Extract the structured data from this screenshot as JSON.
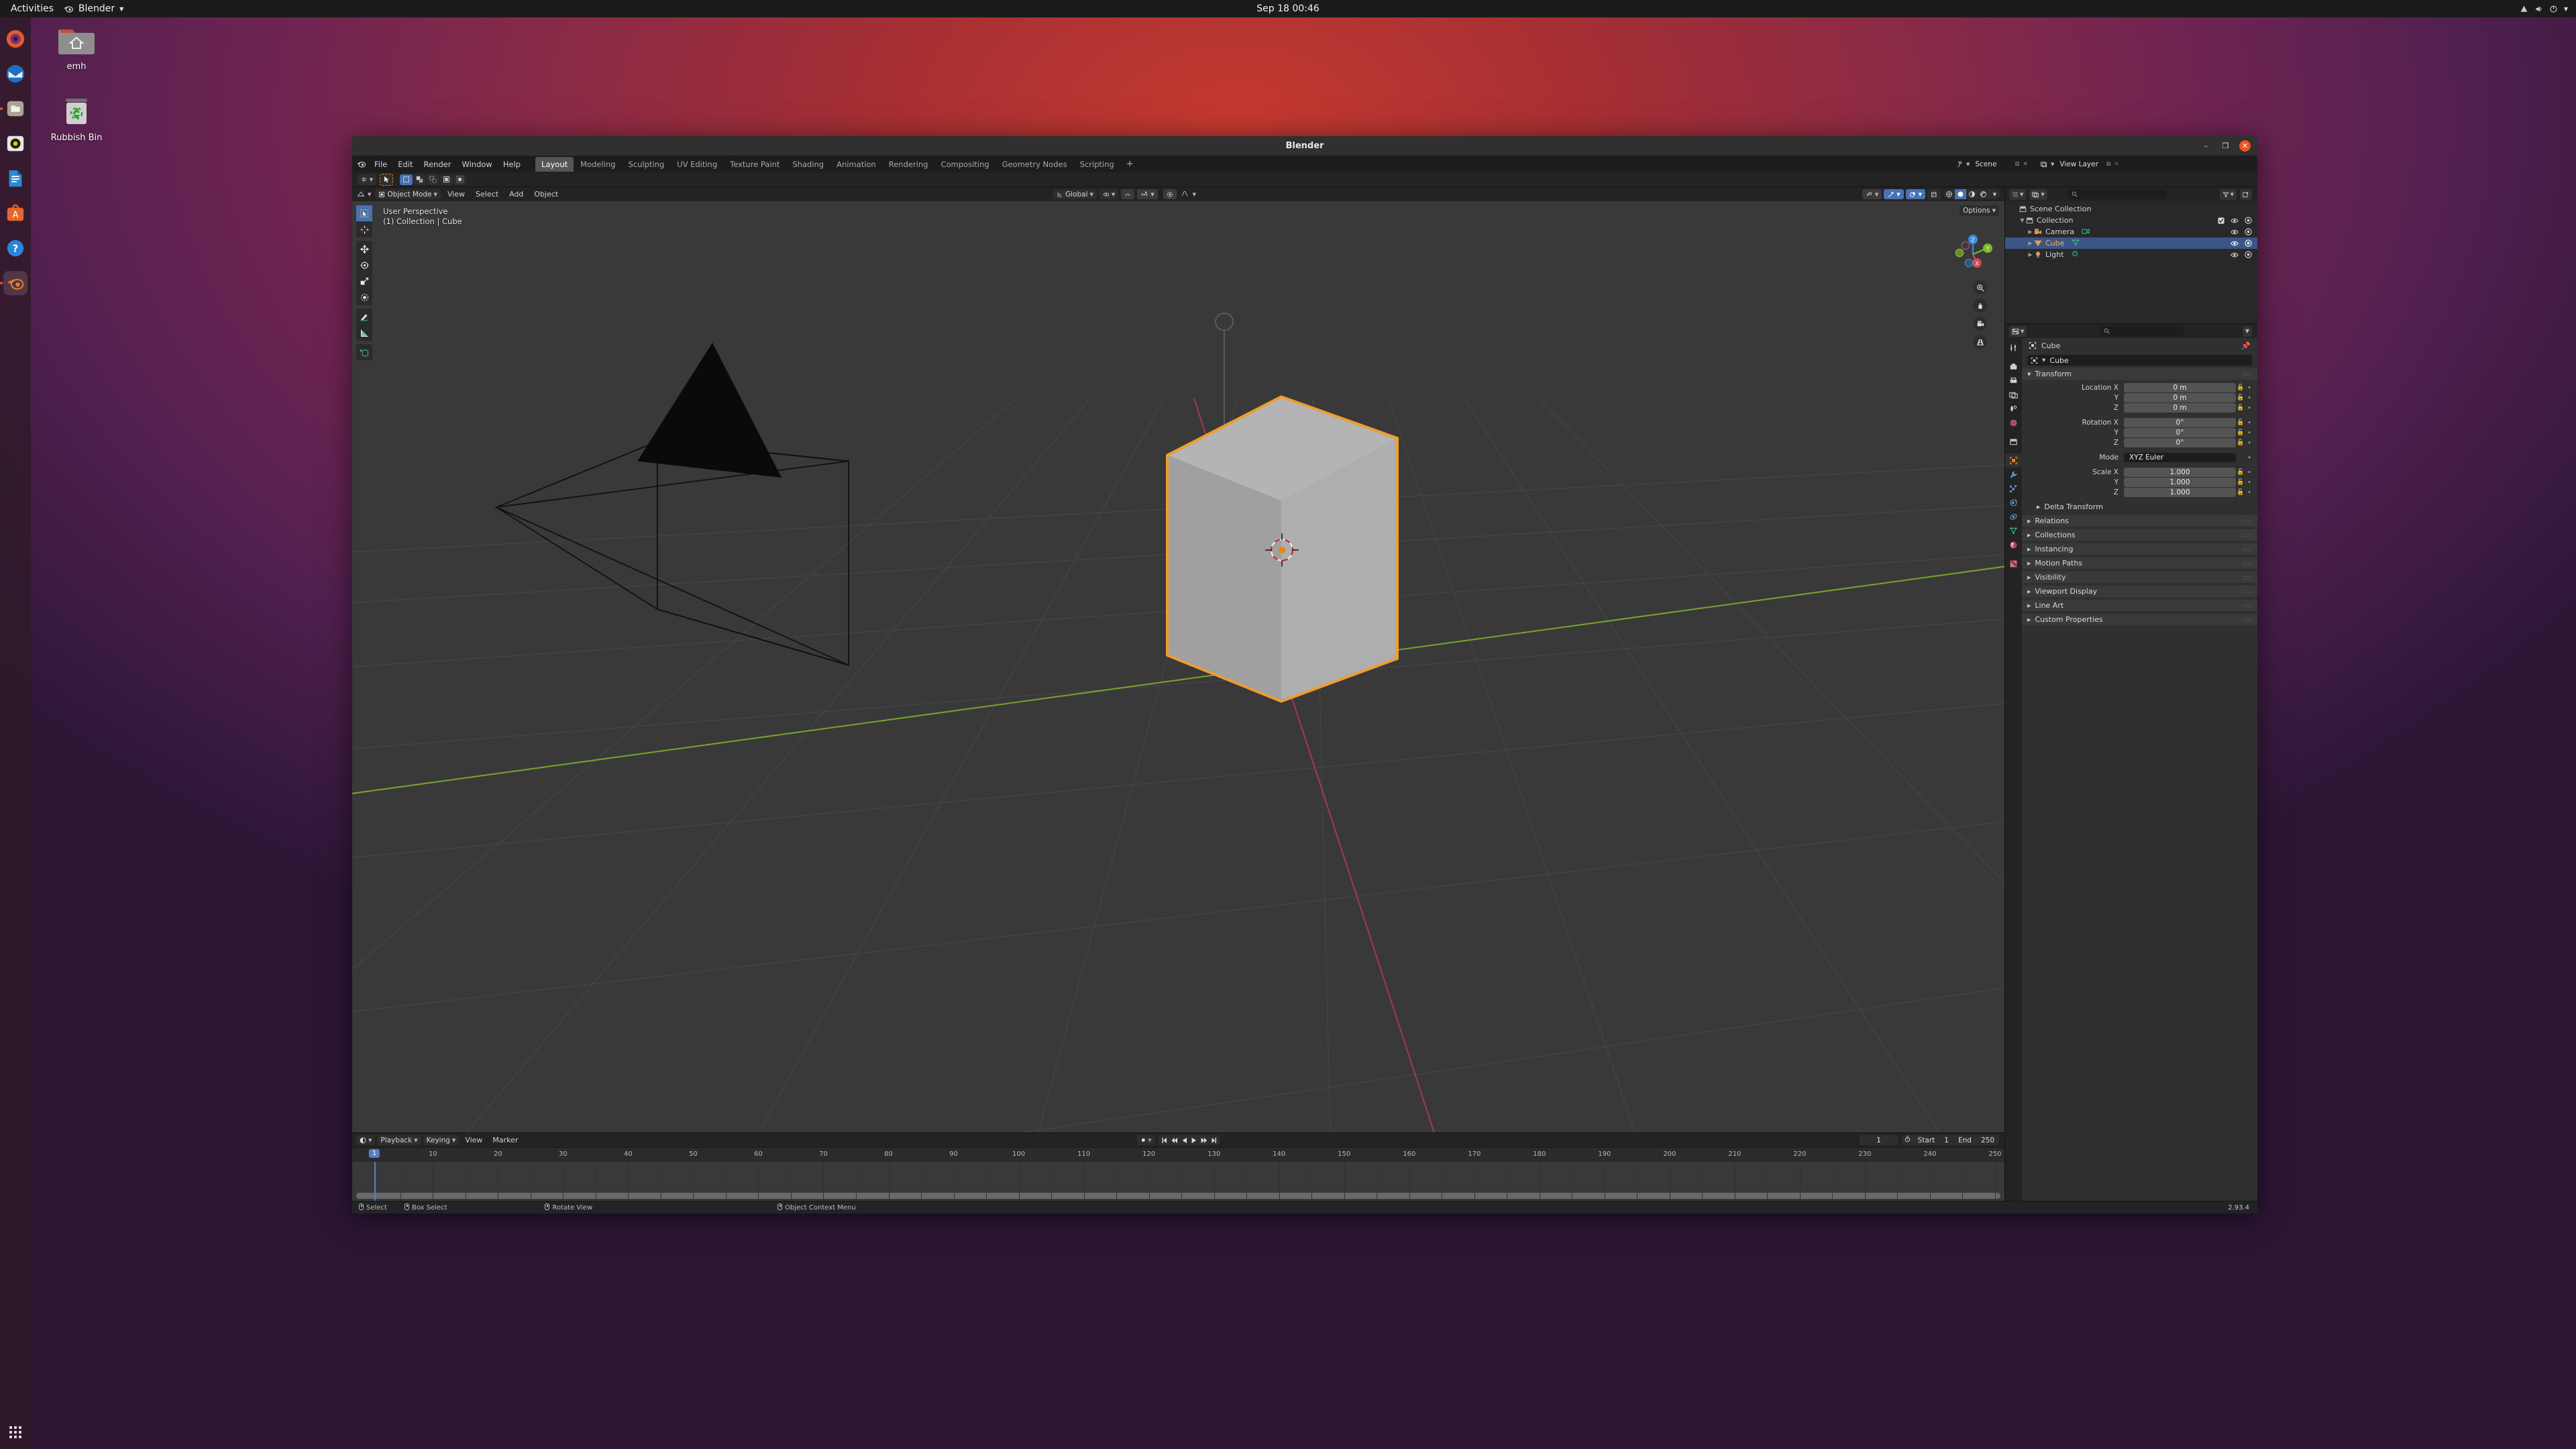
{
  "desktop": {
    "topbar": {
      "activities": "Activities",
      "app_menu": "Blender",
      "clock": "Sep 18  00:46",
      "tray_icons": [
        "network-icon",
        "volume-icon",
        "power-icon",
        "chevron-down-icon"
      ]
    },
    "dock_items": [
      {
        "name": "firefox",
        "running": false
      },
      {
        "name": "thunderbird",
        "running": false
      },
      {
        "name": "files",
        "running": true
      },
      {
        "name": "rhythmbox",
        "running": false
      },
      {
        "name": "libreoffice-writer",
        "running": false
      },
      {
        "name": "ubuntu-software",
        "running": false
      },
      {
        "name": "help",
        "running": false
      },
      {
        "name": "blender",
        "running": true
      }
    ],
    "icons": [
      {
        "label": "emh",
        "type": "home-folder"
      },
      {
        "label": "Rubbish Bin",
        "type": "trash"
      }
    ]
  },
  "window": {
    "title": "Blender",
    "controls": {
      "minimize": "–",
      "maximize": "❐",
      "close": "✕"
    }
  },
  "topbar": {
    "menus": [
      "File",
      "Edit",
      "Render",
      "Window",
      "Help"
    ],
    "workspaces": [
      "Layout",
      "Modeling",
      "Sculpting",
      "UV Editing",
      "Texture Paint",
      "Shading",
      "Animation",
      "Rendering",
      "Compositing",
      "Geometry Nodes",
      "Scripting"
    ],
    "active_workspace": "Layout",
    "add_workspace": "+",
    "scene_name": "Scene",
    "view_layer_name": "View Layer"
  },
  "tool_settings": {
    "mode_icon": "select-mode-icon",
    "cursor_icon": "tweak-cursor-icon",
    "select_modes": [
      "set-select",
      "extend-select",
      "subtract-select",
      "invert-select",
      "intersect-select"
    ],
    "active_select_mode": "set-select"
  },
  "viewport": {
    "header": {
      "mode": "Object Mode",
      "menus": [
        "View",
        "Select",
        "Add",
        "Object"
      ],
      "transform_orientation": "Global",
      "snap_label": "snap-magnet-icon",
      "proportional_label": "proportional-edit-icon",
      "options": "Options",
      "shading_modes": [
        "wireframe",
        "solid",
        "material-preview",
        "rendered"
      ],
      "active_shading": "solid"
    },
    "overlay_line1": "User Perspective",
    "overlay_line2": "(1) Collection | Cube",
    "toolbar_tools": [
      "tweak-select-box",
      "cursor",
      "move",
      "rotate",
      "scale",
      "transform",
      "annotate",
      "measure",
      "add-cube"
    ],
    "active_tool": "tweak-select-box",
    "gizmo_axes": [
      "X",
      "Y",
      "Z"
    ],
    "nav_buttons": [
      "zoom-icon",
      "pan-hand-icon",
      "camera-view-icon",
      "toggle-perspective-icon"
    ],
    "objects": [
      "Cube",
      "Camera",
      "Light"
    ]
  },
  "outliner": {
    "display_mode": "view-layer-icon",
    "filter_icon": "filter-icon",
    "new_collection_icon": "new-collection-icon",
    "search_placeholder": "",
    "rows": [
      {
        "label": "Scene Collection",
        "icon": "collection-icon",
        "indent": 0,
        "selected": false,
        "expander": "",
        "has_toggles": false,
        "data_icon": ""
      },
      {
        "label": "Collection",
        "icon": "collection-icon",
        "indent": 1,
        "selected": false,
        "expander": "▼",
        "has_toggles": true,
        "checkbox": true,
        "data_icon": ""
      },
      {
        "label": "Camera",
        "icon": "camera-object-icon",
        "indent": 2,
        "selected": false,
        "expander": "▶",
        "has_toggles": true,
        "data_icon": "camera-data-icon"
      },
      {
        "label": "Cube",
        "icon": "mesh-object-icon",
        "indent": 2,
        "selected": true,
        "expander": "▶",
        "has_toggles": true,
        "data_icon": "mesh-data-icon"
      },
      {
        "label": "Light",
        "icon": "light-object-icon",
        "indent": 2,
        "selected": false,
        "expander": "▶",
        "has_toggles": true,
        "data_icon": "light-data-icon"
      }
    ]
  },
  "properties": {
    "search_placeholder": "",
    "tabs": [
      "tool-icon",
      "render-icon",
      "output-icon",
      "view-layer-icon",
      "scene-icon",
      "world-icon",
      "collection-icon",
      "object-icon",
      "modifier-icon",
      "particles-icon",
      "physics-icon",
      "constraints-icon",
      "data-icon",
      "material-icon",
      "texture-icon"
    ],
    "active_tab": "object-icon",
    "breadcrumb_object": "Cube",
    "name_field": "Cube",
    "panels": [
      {
        "label": "Transform",
        "open": true
      },
      {
        "label": "Delta Transform",
        "open": false,
        "sub": true
      },
      {
        "label": "Relations",
        "open": false
      },
      {
        "label": "Collections",
        "open": false
      },
      {
        "label": "Instancing",
        "open": false
      },
      {
        "label": "Motion Paths",
        "open": false
      },
      {
        "label": "Visibility",
        "open": false
      },
      {
        "label": "Viewport Display",
        "open": false
      },
      {
        "label": "Line Art",
        "open": false
      },
      {
        "label": "Custom Properties",
        "open": false
      }
    ],
    "transform": {
      "location": [
        {
          "label": "Location X",
          "value": "0 m"
        },
        {
          "label": "Y",
          "value": "0 m"
        },
        {
          "label": "Z",
          "value": "0 m"
        }
      ],
      "rotation": [
        {
          "label": "Rotation X",
          "value": "0°"
        },
        {
          "label": "Y",
          "value": "0°"
        },
        {
          "label": "Z",
          "value": "0°"
        }
      ],
      "mode": {
        "label": "Mode",
        "value": "XYZ Euler"
      },
      "scale": [
        {
          "label": "Scale X",
          "value": "1.000"
        },
        {
          "label": "Y",
          "value": "1.000"
        },
        {
          "label": "Z",
          "value": "1.000"
        }
      ]
    }
  },
  "timeline": {
    "editor_icon": "timeline-editor-icon",
    "menus": [
      "Playback",
      "Keying",
      "View",
      "Marker"
    ],
    "playback_controls": [
      "jump-to-start",
      "jump-prev-keyframe",
      "play-reverse",
      "play",
      "jump-next-keyframe",
      "jump-to-end"
    ],
    "current_frame": "1",
    "start_label": "Start",
    "start_value": "1",
    "end_label": "End",
    "end_value": "250",
    "ruler_ticks": [
      "1",
      "10",
      "20",
      "30",
      "40",
      "50",
      "60",
      "70",
      "80",
      "90",
      "100",
      "110",
      "120",
      "130",
      "140",
      "150",
      "160",
      "170",
      "180",
      "190",
      "200",
      "210",
      "220",
      "230",
      "240",
      "250"
    ],
    "playhead_frame": "1"
  },
  "statusbar": {
    "hints": [
      {
        "icon": "mouse-left-icon",
        "label": "Select"
      },
      {
        "icon": "mouse-left-drag-icon",
        "label": "Box Select"
      },
      {
        "icon": "mouse-middle-icon",
        "label": "Rotate View"
      },
      {
        "icon": "mouse-right-icon",
        "label": "Object Context Menu"
      }
    ],
    "version": "2.93.4"
  },
  "colors": {
    "accent_blue": "#4772b3",
    "accent_orange": "#e8870d",
    "selected_outline": "#ed9e2e",
    "header_bg": "#232323",
    "viewport_bg": "#393939",
    "ubuntu_orange": "#e95420"
  }
}
